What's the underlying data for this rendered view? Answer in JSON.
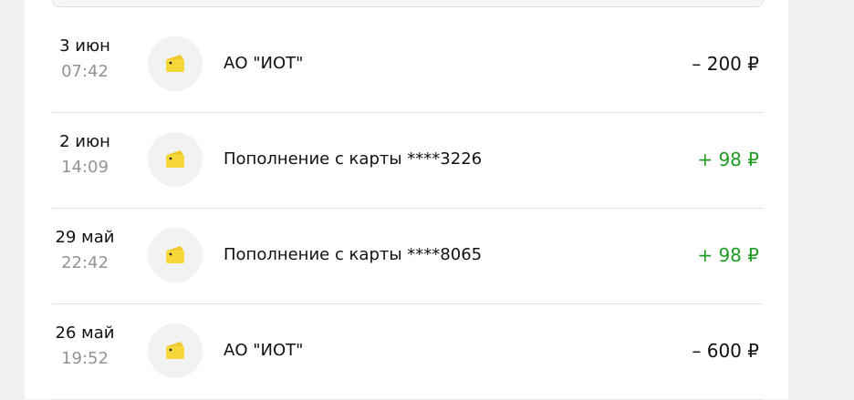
{
  "colors": {
    "background": "#f2f1ef",
    "panel": "#ffffff",
    "credit": "#1f9c24",
    "debit": "#111111",
    "muted": "#939393",
    "icon": "#f5d73a"
  },
  "transactions": [
    {
      "date": "3 июн",
      "time": "07:42",
      "merchant": "АО \"ИОТ\"",
      "amount": "– 200 ₽",
      "direction": "debit",
      "icon": "wallet-icon"
    },
    {
      "date": "2 июн",
      "time": "14:09",
      "merchant": "Пополнение с карты ****3226",
      "amount": "+ 98 ₽",
      "direction": "credit",
      "icon": "wallet-icon"
    },
    {
      "date": "29 май",
      "time": "22:42",
      "merchant": "Пополнение с карты ****8065",
      "amount": "+ 98 ₽",
      "direction": "credit",
      "icon": "wallet-icon"
    },
    {
      "date": "26 май",
      "time": "19:52",
      "merchant": "АО \"ИОТ\"",
      "amount": "– 600 ₽",
      "direction": "debit",
      "icon": "wallet-icon"
    }
  ]
}
